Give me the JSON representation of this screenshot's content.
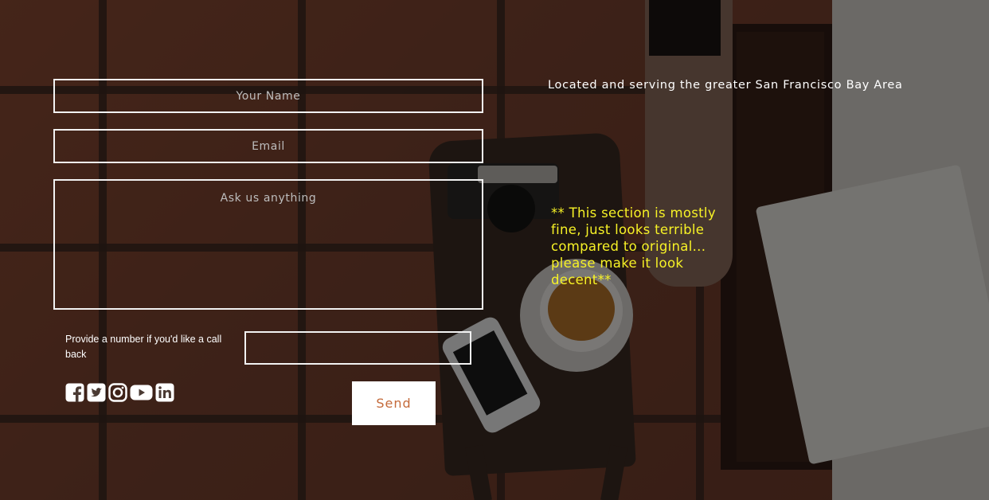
{
  "form": {
    "name_placeholder": "Your Name",
    "email_placeholder": "Email",
    "message_placeholder": "Ask us anything",
    "callback_label": "Provide a number if you'd like a call back",
    "phone_value": "",
    "send_label": "Send"
  },
  "socials": [
    {
      "icon": "facebook-icon"
    },
    {
      "icon": "twitter-icon"
    },
    {
      "icon": "instagram-icon"
    },
    {
      "icon": "youtube-icon"
    },
    {
      "icon": "linkedin-icon"
    }
  ],
  "location_text": "Located and serving the greater San Francisco Bay Area",
  "note_text": "** This section is mostly fine, just looks terrible compared to original... please make it look decent**",
  "colors": {
    "accent": "#c46a3a",
    "note": "#f7f226",
    "border": "#f2f2f2"
  }
}
